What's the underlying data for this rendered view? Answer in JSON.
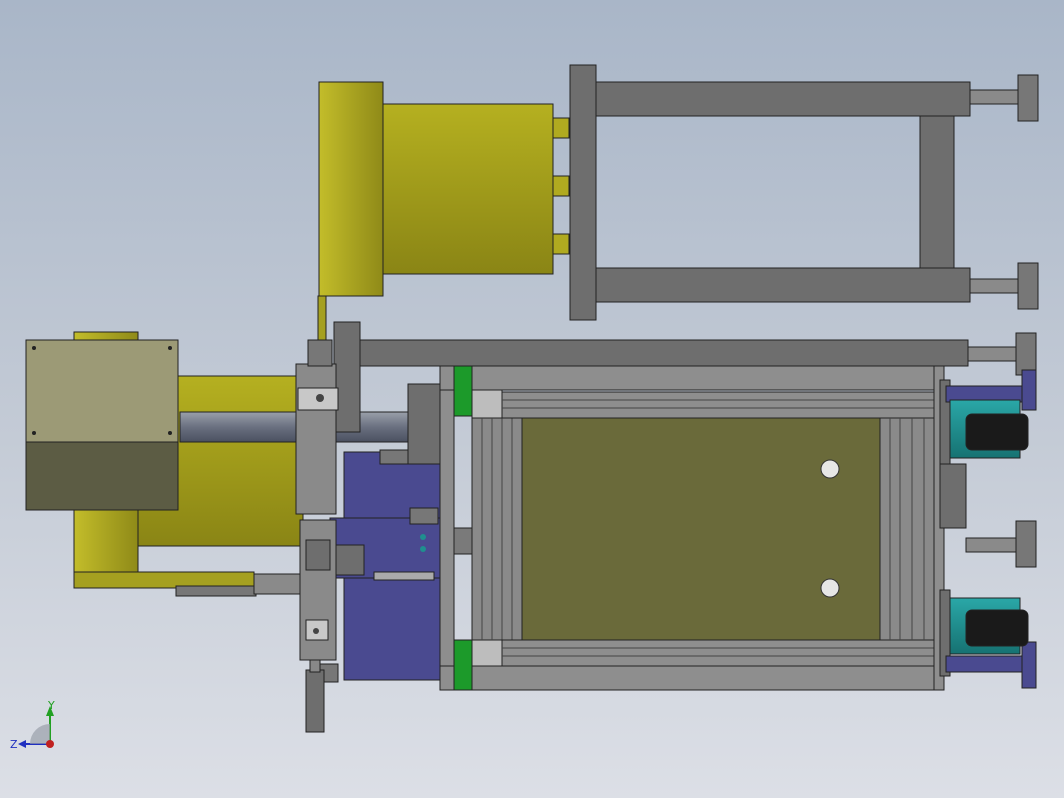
{
  "viewport": {
    "background_top": "#a9b6c8",
    "background_bottom": "#dcdfe6"
  },
  "model": {
    "colors": {
      "yellow_part": "#a5a020",
      "yellow_dark": "#8c8715",
      "gray_frame": "#6e6e6e",
      "gray_light": "#8e8e8e",
      "blue_part": "#4a4a90",
      "teal_motor": "#1f8f8f",
      "green_spacer": "#1c9a2a",
      "plate_olive": "#6a6a3a",
      "box_khaki": "#9c9a76",
      "edge": "#222222"
    }
  },
  "triad": {
    "icon": "coordinate-triad-icon",
    "y_label": "Y",
    "z_label": "Z",
    "y_color": "#22a022",
    "z_color": "#2030c0",
    "origin_color": "#c02020"
  }
}
